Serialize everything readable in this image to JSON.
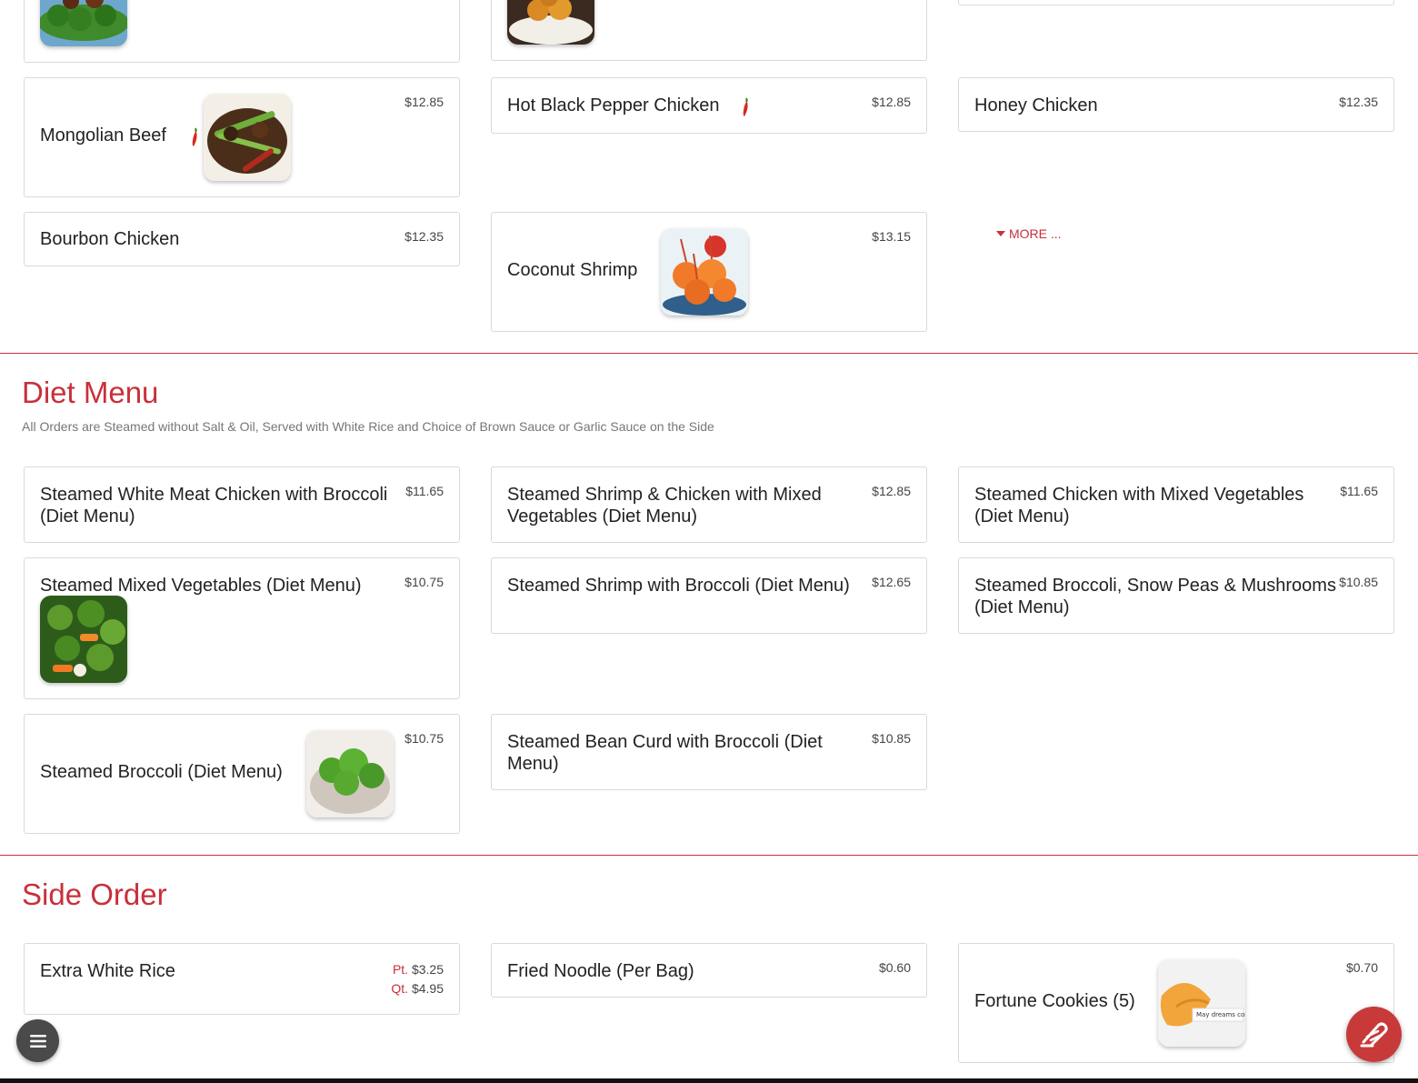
{
  "colors": {
    "accent": "#c8303a",
    "card_border": "#d9d9d9",
    "price_text": "#444444"
  },
  "top_items": [
    {
      "name": "Mongolian Beef",
      "price": "$12.85",
      "spicy": true,
      "image": "mongolian-beef-photo"
    },
    {
      "name": "Hot Black Pepper Chicken",
      "price": "$12.85",
      "spicy": true
    },
    {
      "name": "Honey Chicken",
      "price": "$12.35"
    },
    {
      "name": "Bourbon Chicken",
      "price": "$12.35"
    },
    {
      "name": "Coconut Shrimp",
      "price": "$13.15",
      "image": "coconut-shrimp-photo"
    }
  ],
  "more_label": "MORE ...",
  "diet_menu": {
    "title": "Diet Menu",
    "description": "All Orders are Steamed without Salt & Oil, Served with White Rice and Choice of Brown Sauce or Garlic Sauce on the Side",
    "items": [
      {
        "name": "Steamed White Meat Chicken with Broccoli (Diet Menu)",
        "price": "$11.65"
      },
      {
        "name": "Steamed Shrimp & Chicken with Mixed Vegetables (Diet Menu)",
        "price": "$12.85"
      },
      {
        "name": "Steamed Chicken with Mixed Vegetables (Diet Menu)",
        "price": "$11.65"
      },
      {
        "name": "Steamed Mixed Vegetables (Diet Menu)",
        "price": "$10.75",
        "image": "mixed-vegetables-photo"
      },
      {
        "name": "Steamed Shrimp with Broccoli (Diet Menu)",
        "price": "$12.65"
      },
      {
        "name": "Steamed Broccoli, Snow Peas & Mushrooms (Diet Menu)",
        "price": "$10.85"
      },
      {
        "name": "Steamed Broccoli (Diet Menu)",
        "price": "$10.75",
        "image": "broccoli-photo"
      },
      {
        "name": "Steamed Bean Curd with Broccoli (Diet Menu)",
        "price": "$10.85"
      }
    ]
  },
  "side_order": {
    "title": "Side Order",
    "items": [
      {
        "name": "Extra White Rice",
        "prices": [
          {
            "size": "Pt.",
            "price": "$3.25"
          },
          {
            "size": "Qt.",
            "price": "$4.95"
          }
        ]
      },
      {
        "name": "Fried Noodle (Per Bag)",
        "price": "$0.60"
      },
      {
        "name": "Fortune Cookies (5)",
        "price": "$0.70",
        "image": "fortune-cookie-photo",
        "image_caption": "May dreams come"
      }
    ]
  },
  "buttons": {
    "menu_icon": "hamburger-menu-icon",
    "order_icon": "order-online-icon"
  }
}
